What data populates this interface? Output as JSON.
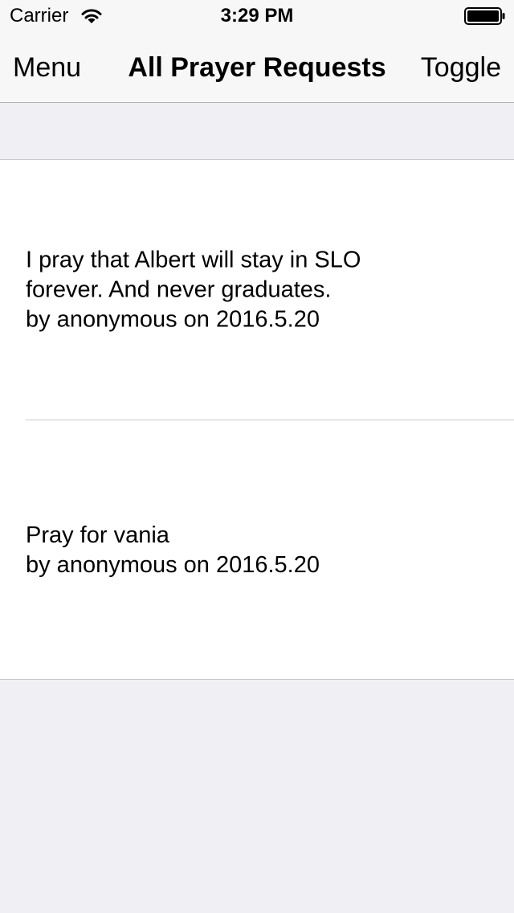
{
  "status_bar": {
    "carrier": "Carrier",
    "time": "3:29 PM",
    "icons": [
      "wifi-icon",
      "battery-icon"
    ]
  },
  "nav_bar": {
    "left_button": "Menu",
    "title": "All Prayer Requests",
    "right_button": "Toggle"
  },
  "requests": [
    {
      "lines": [
        "I pray that Albert will stay in SLO",
        "forever. And never graduates."
      ],
      "byline": "by anonymous on 2016.5.20"
    },
    {
      "lines": [
        "Pray for vania"
      ],
      "byline": "by anonymous on 2016.5.20"
    }
  ],
  "colors": {
    "background": "#efeff4",
    "nav_background": "#f7f7f7",
    "cell_background": "#ffffff",
    "separator": "#c8c7cc"
  }
}
